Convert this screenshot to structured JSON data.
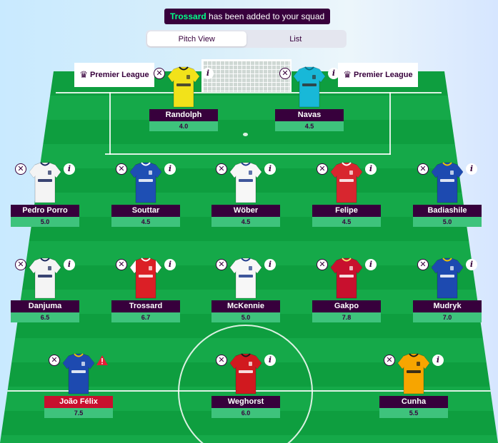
{
  "notice": {
    "highlight": "Trossard",
    "text": " has been added to your squad"
  },
  "view_tabs": [
    {
      "label": "Pitch View",
      "active": true
    },
    {
      "label": "List",
      "active": false
    }
  ],
  "boards": {
    "left": "Premier League",
    "right": "Premier League"
  },
  "colors": {
    "brand": "#37003c",
    "accent": "#00ff87",
    "price_bg": "#3ec37c",
    "flag": "#c8102e"
  },
  "icons": {
    "remove": "close-icon",
    "info": "info-icon",
    "warning": "warning-icon"
  },
  "goalkeepers": [
    {
      "name": "Randolph",
      "price": "4.0",
      "kit": "yellow-gk"
    },
    {
      "name": "Navas",
      "price": "4.5",
      "kit": "cyan-gk"
    }
  ],
  "defenders": [
    {
      "name": "Pedro Porro",
      "price": "5.0",
      "kit": "spurs"
    },
    {
      "name": "Souttar",
      "price": "4.5",
      "kit": "leicester"
    },
    {
      "name": "Wöber",
      "price": "4.5",
      "kit": "leeds"
    },
    {
      "name": "Felipe",
      "price": "4.5",
      "kit": "forest"
    },
    {
      "name": "Badiashile",
      "price": "5.0",
      "kit": "chelsea"
    }
  ],
  "midfielders": [
    {
      "name": "Danjuma",
      "price": "6.5",
      "kit": "spurs"
    },
    {
      "name": "Trossard",
      "price": "6.7",
      "kit": "arsenal"
    },
    {
      "name": "McKennie",
      "price": "5.0",
      "kit": "leeds"
    },
    {
      "name": "Gakpo",
      "price": "7.8",
      "kit": "liverpool"
    },
    {
      "name": "Mudryk",
      "price": "7.0",
      "kit": "chelsea"
    }
  ],
  "forwards": [
    {
      "name": "João Félix",
      "price": "7.5",
      "kit": "chelsea",
      "flagged": true
    },
    {
      "name": "Weghorst",
      "price": "6.0",
      "kit": "manutd"
    },
    {
      "name": "Cunha",
      "price": "5.5",
      "kit": "wolves"
    }
  ]
}
